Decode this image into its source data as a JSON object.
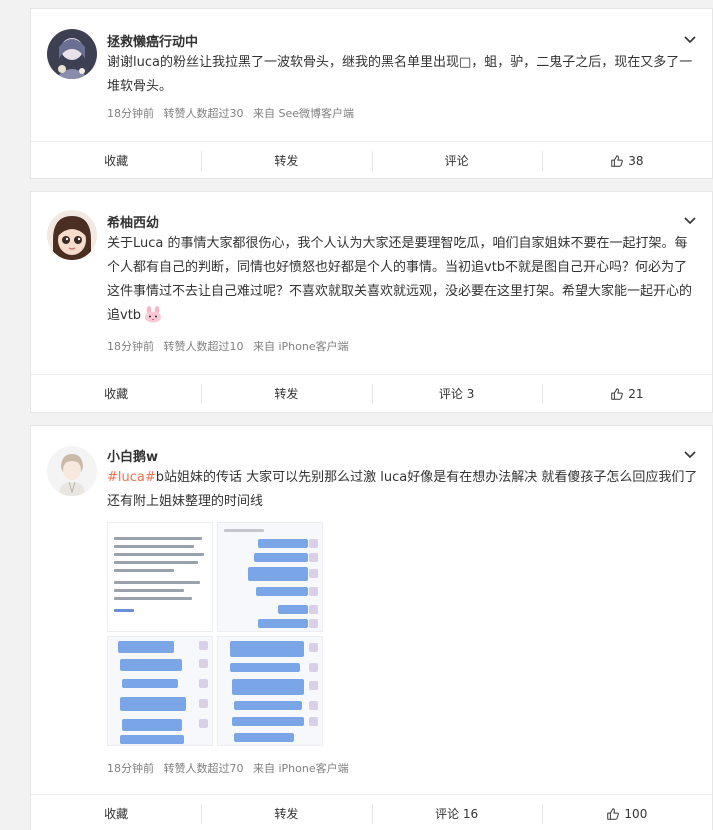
{
  "posts": [
    {
      "username": "拯救懒癌行动中",
      "text": "谢谢luca的粉丝让我拉黑了一波软骨头，继我的黑名单里出现□，蛆，驴，二鬼子之后，现在又多了一堆软骨头。",
      "time": "18分钟前",
      "reposts_info": "转赞人数超过30",
      "source": "来自 See微博客户端",
      "actions": {
        "favorite": "收藏",
        "repost": "转发",
        "comment": "评论",
        "likes": "38"
      }
    },
    {
      "username": "希柚西幼",
      "text": "关于Luca 的事情大家都很伤心，我个人认为大家还是要理智吃瓜，咱们自家姐妹不要在一起打架。每个人都有自己的判断，同情也好愤怒也好都是个人的事情。当初追vtb不就是图自己开心吗？何必为了这件事情过不去让自己难过呢？不喜欢就取关喜欢就远观，没必要在这里打架。希望大家能一起开心的追vtb",
      "time": "18分钟前",
      "reposts_info": "转赞人数超过10",
      "source": "来自 iPhone客户端",
      "actions": {
        "favorite": "收藏",
        "repost": "转发",
        "comment": "评论 3",
        "likes": "21"
      }
    },
    {
      "username": "小白鹅w",
      "tag": "#luca#",
      "text": "b站姐妹的传话 大家可以先别那么过激 luca好像是有在想办法解决 就看傻孩子怎么回应我们了 还有附上姐妹整理的时间线",
      "time": "18分钟前",
      "reposts_info": "转赞人数超过70",
      "source": "来自 iPhone客户端",
      "actions": {
        "favorite": "收藏",
        "repost": "转发",
        "comment": "评论 16",
        "likes": "100"
      }
    }
  ],
  "colors": {
    "tag": "#eb7350",
    "meta": "#808080",
    "bubble_blue": "#7aa5e6"
  }
}
